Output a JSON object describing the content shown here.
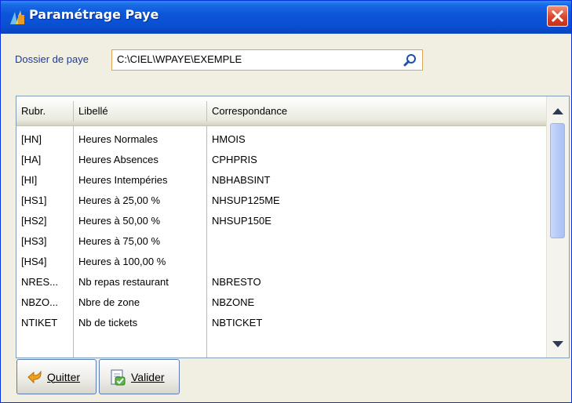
{
  "window": {
    "title": "Paramétrage Paye"
  },
  "folder": {
    "label": "Dossier de paye",
    "value": "C:\\CIEL\\WPAYE\\EXEMPLE"
  },
  "grid": {
    "columns": [
      "Rubr.",
      "Libellé",
      "Correspondance"
    ],
    "rows": [
      {
        "code": "[HN]",
        "label": "Heures Normales",
        "match": "HMOIS"
      },
      {
        "code": "[HA]",
        "label": "Heures Absences",
        "match": "CPHPRIS"
      },
      {
        "code": "[HI]",
        "label": "Heures Intempéries",
        "match": "NBHABSINT"
      },
      {
        "code": "[HS1]",
        "label": "Heures à 25,00 %",
        "match": "NHSUP125ME"
      },
      {
        "code": "[HS2]",
        "label": "Heures à 50,00 %",
        "match": "NHSUP150E"
      },
      {
        "code": "[HS3]",
        "label": "Heures à 75,00 %",
        "match": ""
      },
      {
        "code": "[HS4]",
        "label": "Heures à 100,00 %",
        "match": ""
      },
      {
        "code": "NRES...",
        "label": "Nb repas restaurant",
        "match": "NBRESTO"
      },
      {
        "code": "NBZO...",
        "label": "Nbre de zone",
        "match": "NBZONE"
      },
      {
        "code": "NTIKET",
        "label": "Nb de tickets",
        "match": "NBTICKET"
      }
    ]
  },
  "buttons": {
    "quit": "Quitter",
    "validate": "Valider"
  },
  "icons": {
    "title": "app-logo-icon",
    "close": "close-icon",
    "search": "search-icon",
    "quit": "back-arrow-icon",
    "validate": "validate-document-icon"
  },
  "colors": {
    "titlebar": "#0a4fd1",
    "close": "#d9452c",
    "field_border": "#e0a45a",
    "label_text": "#1f3a9a"
  }
}
